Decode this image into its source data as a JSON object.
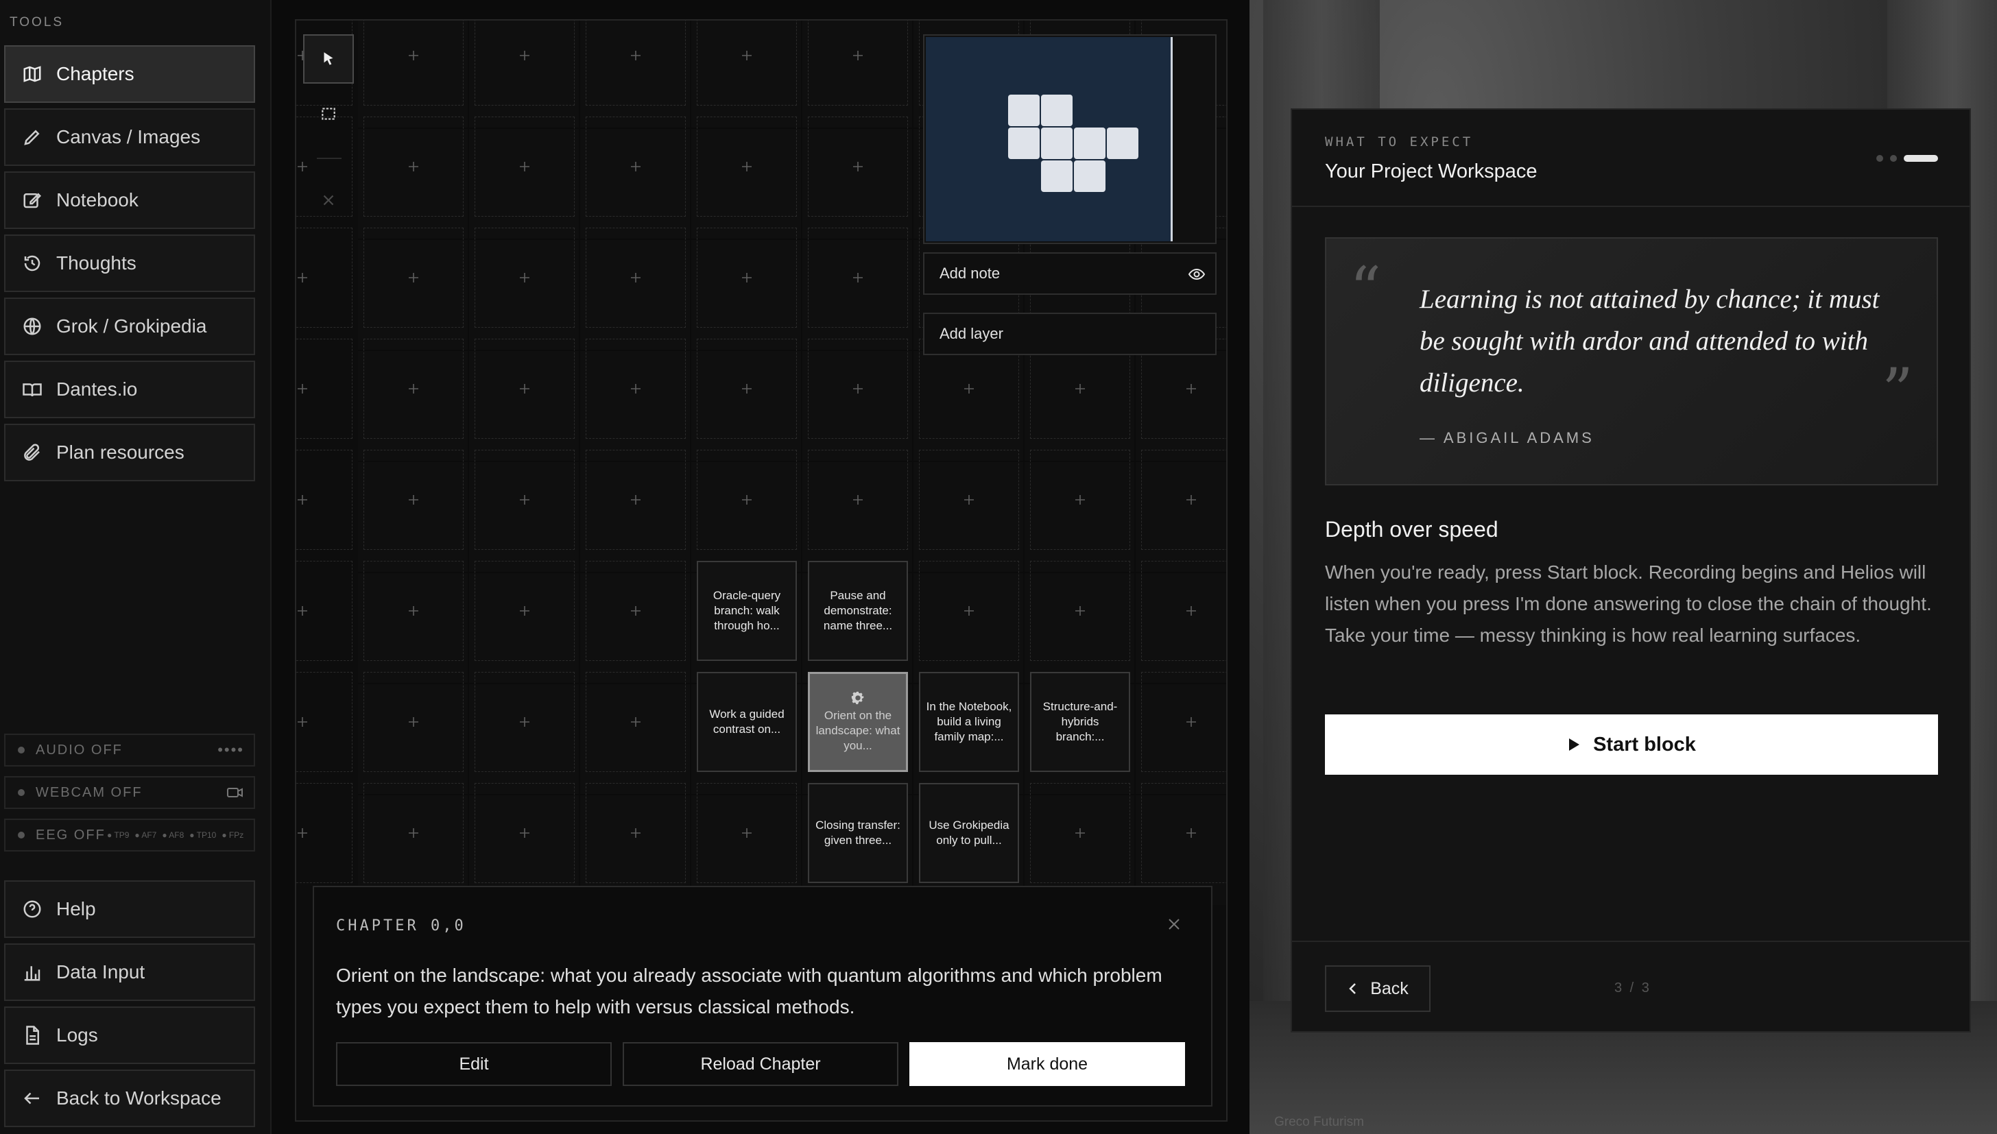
{
  "sidebar": {
    "tools_label": "TOOLS",
    "nav": [
      {
        "label": "Chapters",
        "icon": "map-icon",
        "active": true
      },
      {
        "label": "Canvas / Images",
        "icon": "pencil-icon"
      },
      {
        "label": "Notebook",
        "icon": "edit-icon"
      },
      {
        "label": "Thoughts",
        "icon": "history-icon"
      },
      {
        "label": "Grok / Grokipedia",
        "icon": "globe-icon"
      },
      {
        "label": "Dantes.io",
        "icon": "book-icon"
      },
      {
        "label": "Plan resources",
        "icon": "paperclip-icon"
      }
    ],
    "sensors": {
      "audio": "AUDIO OFF",
      "webcam": "WEBCAM OFF",
      "eeg": "EEG OFF",
      "eeg_channels": [
        "TP9",
        "AF7",
        "AF8",
        "TP10",
        "FPz"
      ]
    },
    "bottom_nav": [
      {
        "label": "Help",
        "icon": "help-icon"
      },
      {
        "label": "Data Input",
        "icon": "chart-icon"
      },
      {
        "label": "Logs",
        "icon": "file-icon"
      },
      {
        "label": "Back to Workspace",
        "icon": "arrow-left-icon"
      }
    ]
  },
  "canvas": {
    "nodes": {
      "n_5_3": "Oracle-query branch: walk through ho...",
      "n_5_4": "Pause and demonstrate: name three...",
      "n_6_3": "Work a guided contrast on...",
      "n_6_4": "Orient on the landscape: what you...",
      "n_6_5": "In the Notebook, build a living family map:...",
      "n_6_6": "Structure-and-hybrids branch:...",
      "n_7_4": "Closing transfer: given three...",
      "n_7_5": "Use Grokipedia only to pull..."
    },
    "panel": {
      "add_note": "Add note",
      "add_layer": "Add layer"
    },
    "chapter": {
      "caption": "CHAPTER 0,0",
      "description": "Orient on the landscape: what you already associate with quantum algorithms and which problem types you expect them to help with versus classical methods.",
      "edit": "Edit",
      "reload": "Reload Chapter",
      "mark_done": "Mark done"
    }
  },
  "card": {
    "eyebrow": "WHAT TO EXPECT",
    "title": "Your Project Workspace",
    "quote": {
      "text": "Learning is not attained by chance; it must be sought with ardor and attended to with diligence.",
      "author": "— ABIGAIL ADAMS"
    },
    "subtitle": "Depth over speed",
    "body": "When you're ready, press Start block. Recording begins and Helios will listen when you press I'm done answering to close the chain of thought. Take your time — messy thinking is how real learning surfaces.",
    "start_label": "Start block",
    "back_label": "Back",
    "pager": "3 / 3"
  },
  "credit": "Greco Futurism"
}
